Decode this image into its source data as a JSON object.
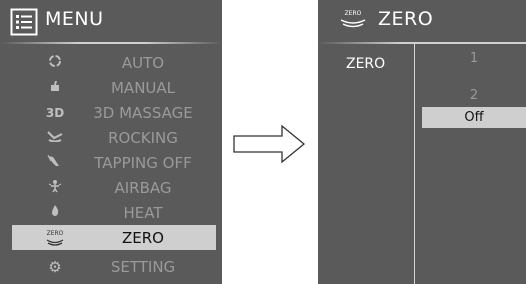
{
  "left_panel": {
    "title": "MENU",
    "items": [
      {
        "icon": "auto-icon",
        "label": "AUTO",
        "selected": false
      },
      {
        "icon": "manual-icon",
        "label": "MANUAL",
        "selected": false
      },
      {
        "icon": "3d-icon",
        "icon_text": "3D",
        "label": "3D MASSAGE",
        "selected": false
      },
      {
        "icon": "rocking-icon",
        "label": "ROCKING",
        "selected": false
      },
      {
        "icon": "tapping-icon",
        "label": "TAPPING OFF",
        "selected": false
      },
      {
        "icon": "airbag-icon",
        "label": "AIRBAG",
        "selected": false
      },
      {
        "icon": "heat-icon",
        "label": "HEAT",
        "selected": false
      },
      {
        "icon": "zero-icon",
        "icon_text": "ZERO",
        "label": "ZERO",
        "selected": true
      },
      {
        "icon": "setting-icon",
        "label": "SETTING",
        "selected": false
      }
    ]
  },
  "right_panel": {
    "icon_text": "ZERO",
    "title": "ZERO",
    "row_label": "ZERO",
    "options": [
      {
        "label": "1",
        "selected": false
      },
      {
        "label": "2",
        "selected": false
      },
      {
        "label": "Off",
        "selected": true
      }
    ]
  },
  "colors": {
    "panel": "#5a5a5a",
    "highlight": "#cfcfcf",
    "text_dim": "#9a9a9a",
    "text_light": "#ffffff"
  }
}
